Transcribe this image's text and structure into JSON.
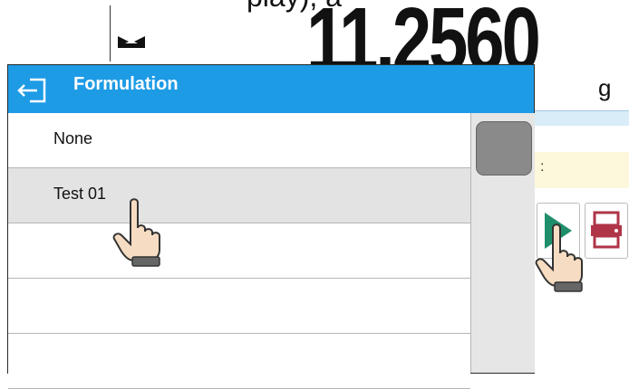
{
  "background": {
    "top_text": "play), a",
    "weight_value": "11.2560",
    "unit": "g",
    "field_text": ":"
  },
  "dialog": {
    "title": "Formulation",
    "items": [
      {
        "label": "None",
        "selected": false
      },
      {
        "label": "Test 01",
        "selected": true
      },
      {
        "label": "",
        "selected": false
      },
      {
        "label": "",
        "selected": false
      },
      {
        "label": "",
        "selected": false
      }
    ]
  },
  "colors": {
    "header": "#1e9be5",
    "selected_row": "#e3e3e3",
    "play_green": "#1f8e6b",
    "print_red": "#b03448"
  },
  "icons": [
    "back-exit-icon",
    "stable-marker-icon",
    "play-icon",
    "printer-icon",
    "pointing-hand-icon"
  ]
}
